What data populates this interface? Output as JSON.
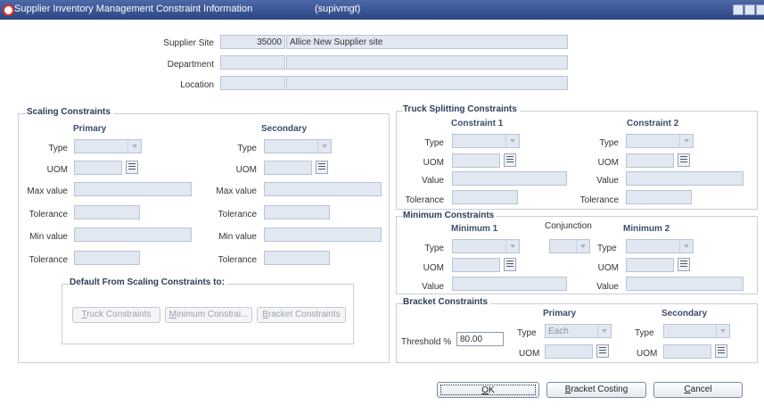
{
  "window": {
    "title": "Supplier Inventory Management Constraint Information",
    "subtitle": "(supivmgt)"
  },
  "header": {
    "supplier_site_label": "Supplier Site",
    "supplier_site_id": "35000",
    "supplier_site_name": "Allice New Supplier site",
    "department_label": "Department",
    "location_label": "Location"
  },
  "scaling": {
    "title": "Scaling Constraints",
    "primary_header": "Primary",
    "secondary_header": "Secondary",
    "type_label": "Type",
    "uom_label": "UOM",
    "max_label": "Max value",
    "tol_label": "Tolerance",
    "min_label": "Min value",
    "default_title": "Default From Scaling Constraints to:",
    "truck_btn_t": "T",
    "truck_btn_rest": "ruck Constraints",
    "minimum_btn_m": "M",
    "minimum_btn_rest": "inimum Constrai...",
    "bracket_btn_b": "B",
    "bracket_btn_rest": "racket Constraints"
  },
  "truck": {
    "title": "Truck Splitting Constraints",
    "c1_header": "Constraint 1",
    "c2_header": "Constraint 2",
    "type_label": "Type",
    "uom_label": "UOM",
    "value_label": "Value",
    "tol_label": "Tolerance"
  },
  "minimum": {
    "title": "Minimum Constraints",
    "m1_header": "Minimum 1",
    "m2_header": "Minimum 2",
    "conjunction_label": "Conjunction",
    "type_label": "Type",
    "uom_label": "UOM",
    "value_label": "Value"
  },
  "bracket": {
    "title": "Bracket Constraints",
    "primary_header": "Primary",
    "secondary_header": "Secondary",
    "threshold_label": "Threshold %",
    "threshold_value": "80.00",
    "type_label": "Type",
    "uom_label": "UOM",
    "primary_type_value": "Each"
  },
  "footer": {
    "ok_label": "OK",
    "ok_mnemonic": "O",
    "ok_rest": "K",
    "bracket_costing_b": "B",
    "bracket_costing_rest": "racket Costing",
    "cancel_c": "C",
    "cancel_rest": "ancel"
  },
  "colors": {
    "titlebar": "#3a5594",
    "field_bg": "#e1e8f2",
    "section_text": "#2f3d57"
  },
  "icons": [
    "oracle-logo-icon",
    "minimize-icon",
    "maximize-icon",
    "close-icon",
    "lov-list-icon",
    "dropdown-arrow-icon"
  ]
}
